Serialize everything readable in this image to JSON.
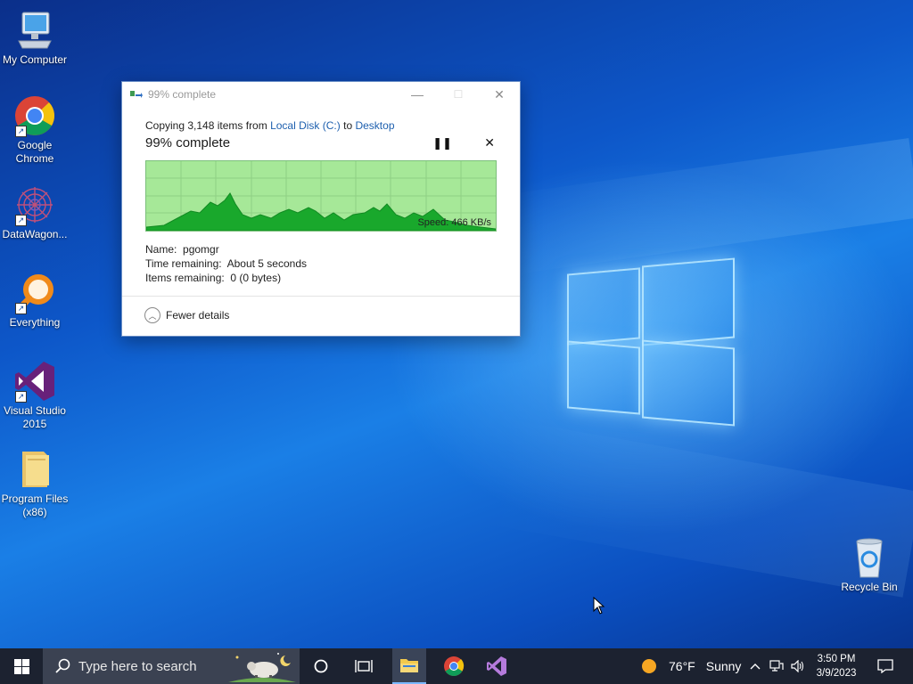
{
  "desktop": {
    "icons": [
      {
        "label": "My Computer"
      },
      {
        "label": "Google Chrome"
      },
      {
        "label": "DataWagon..."
      },
      {
        "label": "Everything"
      },
      {
        "label": "Visual Studio 2015"
      },
      {
        "label": "Program Files (x86)"
      },
      {
        "label": "Recycle Bin"
      }
    ]
  },
  "dialog": {
    "title": "99% complete",
    "copy_prefix": "Copying 3,148 items from",
    "source": "Local Disk (C:)",
    "to_word": "to",
    "destination": "Desktop",
    "percent_text": "99% complete",
    "pause_icon": "pause-icon",
    "cancel_icon": "close-icon",
    "speed": "Speed: 466 KB/s",
    "name_label": "Name:",
    "name_value": "pgomgr",
    "time_label": "Time remaining:",
    "time_value": "About 5 seconds",
    "items_label": "Items remaining:",
    "items_value": "0 (0 bytes)",
    "fewer_details": "Fewer details",
    "colors": {
      "graph_bg": "#a6e898",
      "graph_fill": "#19a82c",
      "link": "#1d5fae"
    }
  },
  "taskbar": {
    "search_placeholder": "Type here to search",
    "weather_temp": "76°F",
    "weather_desc": "Sunny",
    "time": "3:50 PM",
    "date": "3/9/2023",
    "colors": {
      "bar": "#1c2230",
      "search": "#3b4252"
    }
  }
}
